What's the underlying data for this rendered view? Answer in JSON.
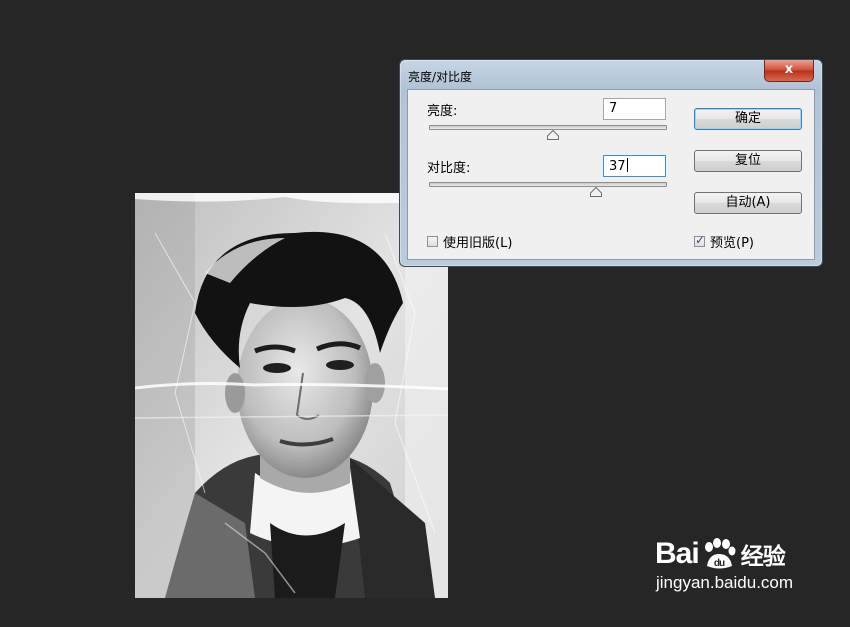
{
  "dialog": {
    "title": "亮度/对比度",
    "close_label": "x",
    "brightness": {
      "label": "亮度:",
      "value": "7",
      "slider_fraction": 0.52
    },
    "contrast": {
      "label": "对比度:",
      "value": "37",
      "slider_fraction": 0.7
    },
    "buttons": {
      "ok": "确定",
      "reset": "复位",
      "auto": "自动(A)"
    },
    "legacy": {
      "label": "使用旧版(L)",
      "checked": false
    },
    "preview": {
      "label": "预览(P)",
      "checked": true
    }
  },
  "watermark": {
    "logo_left": "Bai",
    "logo_right": "经验",
    "url": "jingyan.baidu.com"
  },
  "colors": {
    "background": "#262626",
    "dialog_title_gradient": "#c7d6e6",
    "close_button": "#c8452f"
  },
  "icons": {
    "close": "close-icon",
    "slider_thumb": "triangle-thumb-icon",
    "watermark_paw": "paw-icon"
  }
}
